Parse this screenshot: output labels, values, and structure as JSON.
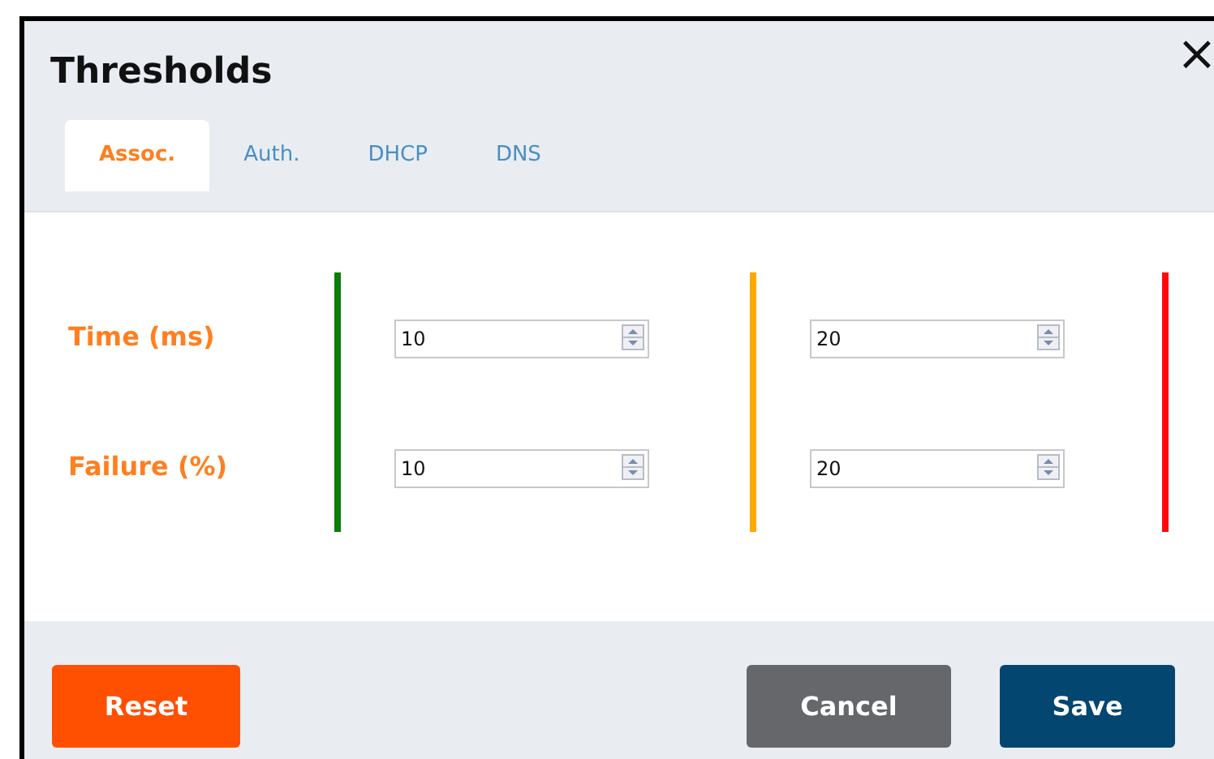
{
  "dialog": {
    "title": "Thresholds",
    "close": "×"
  },
  "tabs": [
    {
      "label": "Assoc.",
      "selected": true
    },
    {
      "label": "Auth.",
      "selected": false
    },
    {
      "label": "DHCP",
      "selected": false
    },
    {
      "label": "DNS",
      "selected": false
    }
  ],
  "threshold_bars": [
    {
      "color": "#0a7d0a"
    },
    {
      "color": "#ffa800"
    },
    {
      "color": "#ff0a0a"
    }
  ],
  "rows": [
    {
      "label": "Time (ms)",
      "values": [
        "10",
        "20"
      ]
    },
    {
      "label": "Failure (%)",
      "values": [
        "10",
        "20"
      ]
    }
  ],
  "buttons": [
    {
      "label": "Reset",
      "kind": "reset"
    },
    {
      "label": "Cancel",
      "kind": "cancel"
    },
    {
      "label": "Save",
      "kind": "save"
    }
  ]
}
